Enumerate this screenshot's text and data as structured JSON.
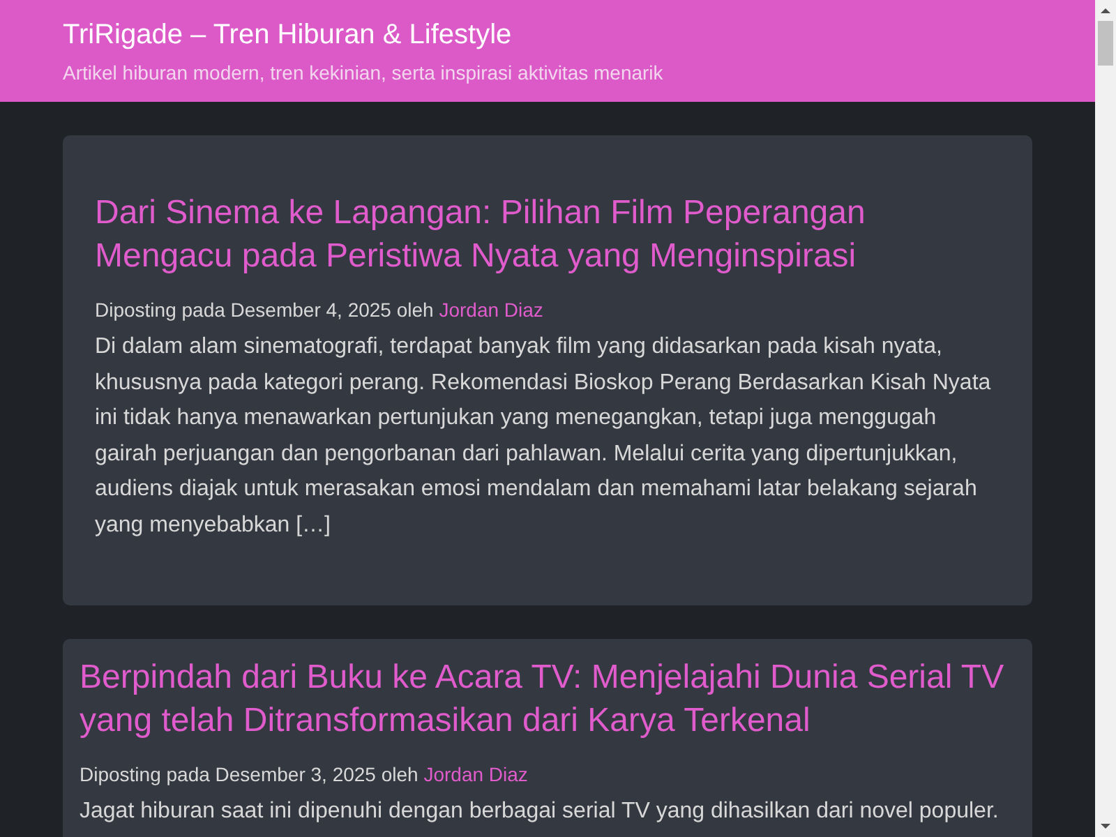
{
  "site": {
    "title": "TriRigade – Tren Hiburan & Lifestyle",
    "tagline": "Artikel hiburan modern, tren kekinian, serta inspirasi aktivitas menarik"
  },
  "posts": [
    {
      "kind": "sticky",
      "title": "Dari Sinema ke Lapangan: Pilihan Film Peperangan Mengacu pada Peristiwa Nyata yang Menginspirasi",
      "meta": "Diposting pada Desember 4, 2025 oleh",
      "author": "Jordan Diaz",
      "excerpt": "Di dalam alam sinematografi, terdapat banyak film yang didasarkan pada kisah nyata, khususnya pada kategori perang. Rekomendasi Bioskop Perang Berdasarkan Kisah Nyata ini tidak hanya menawarkan pertunjukan yang menegangkan, tetapi juga menggugah gairah perjuangan dan pengorbanan dari pahlawan. Melalui cerita yang dipertunjukkan, audiens diajak untuk merasakan emosi mendalam dan memahami latar belakang sejarah yang menyebabkan […]"
    },
    {
      "kind": "standard",
      "title": "Berpindah dari Buku ke Acara TV: Menjelajahi Dunia Serial TV yang telah Ditransformasikan dari Karya Terkenal",
      "meta": "Diposting pada Desember 3, 2025 oleh",
      "author": "Jordan Diaz",
      "excerpt": "Jagat hiburan saat ini dipenuhi dengan berbagai serial TV yang dihasilkan dari novel populer."
    }
  ]
}
